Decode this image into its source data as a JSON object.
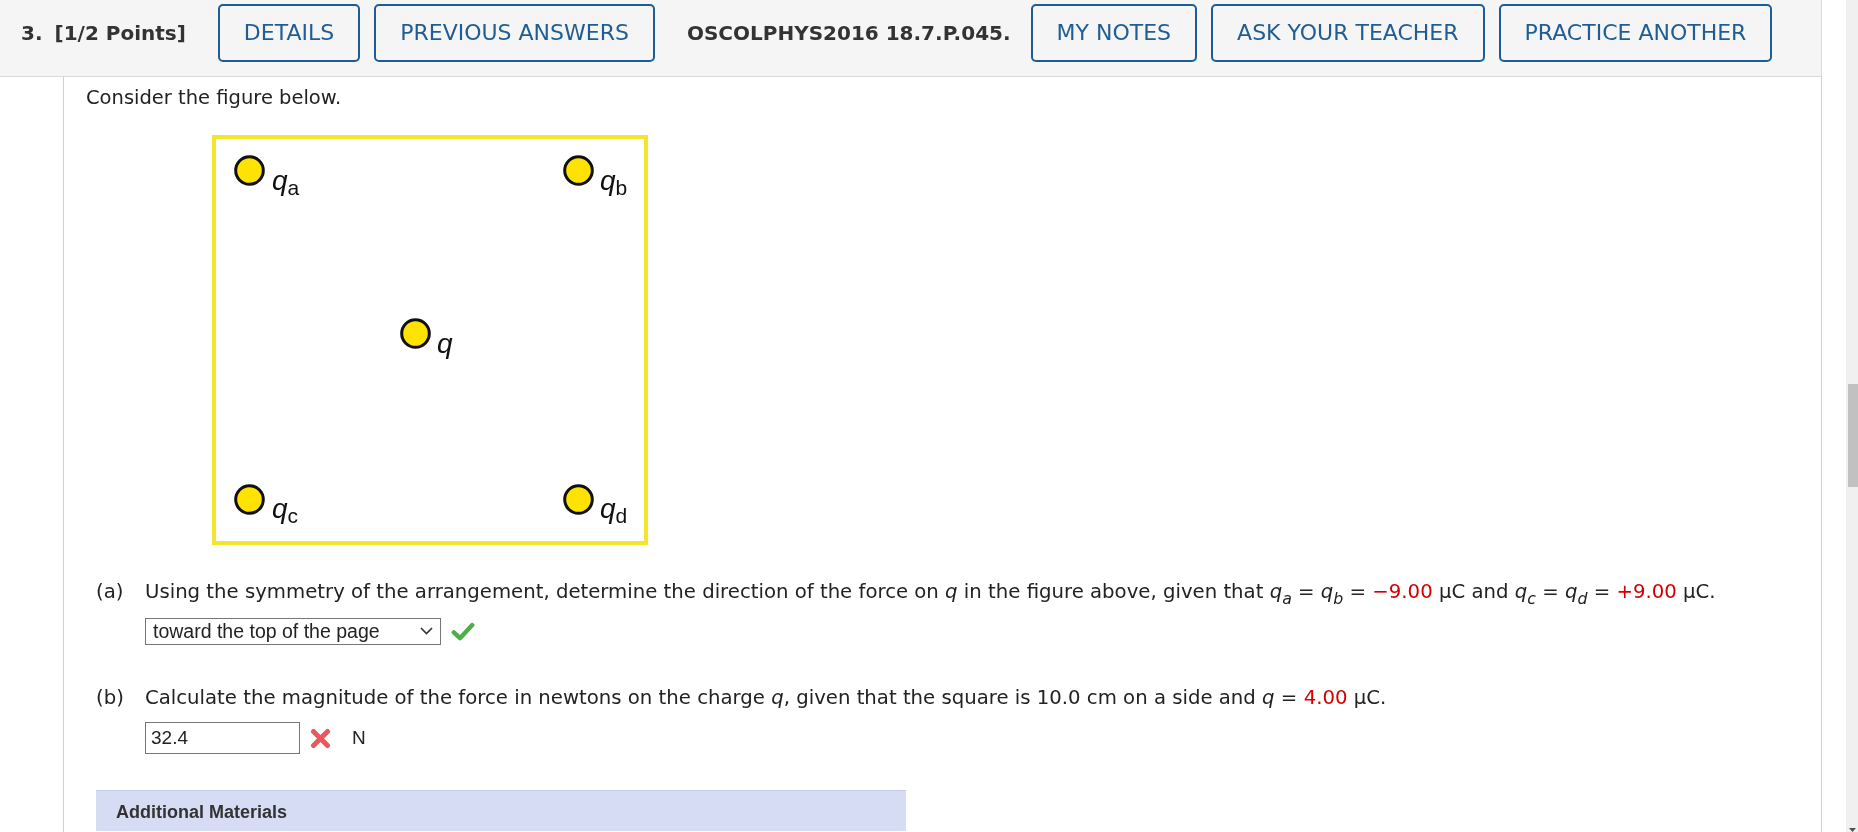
{
  "header": {
    "number": "3.",
    "points": "[1/2 Points]",
    "items": [
      {
        "kind": "button",
        "label": "DETAILS"
      },
      {
        "kind": "button",
        "label": "PREVIOUS ANSWERS"
      },
      {
        "kind": "code",
        "label": "OSCOLPHYS2016 18.7.P.045."
      },
      {
        "kind": "button",
        "label": "MY NOTES"
      },
      {
        "kind": "button",
        "label": "ASK YOUR TEACHER"
      },
      {
        "kind": "button",
        "label": "PRACTICE ANOTHER"
      }
    ]
  },
  "intro": "Consider the figure below.",
  "figure": {
    "charges": [
      {
        "label": "q$_{a}$"
      },
      {
        "label": "q$_{b}$"
      },
      {
        "label": "q"
      },
      {
        "label": "q$_{c}$"
      },
      {
        "label": "q$_{d}$"
      }
    ]
  },
  "parts": [
    {
      "label": "(a)",
      "segments": [
        {
          "kind": "text",
          "text": "Using the symmetry of the arrangement, determine the direction of the force on *q* in the figure above, given that *q*$_{a}$ = *q*$_{b}$ = "
        },
        {
          "kind": "value",
          "text": "−9.00"
        },
        {
          "kind": "text",
          "text": " µC and *q*$_{c}$ = *q*$_{d}$ = "
        },
        {
          "kind": "value",
          "text": "+9.00"
        },
        {
          "kind": "text",
          "text": " µC."
        }
      ],
      "answer": {
        "kind": "select",
        "value": "toward the top of the page",
        "correct": true
      }
    },
    {
      "label": "(b)",
      "segments": [
        {
          "kind": "text",
          "text": "Calculate the magnitude of the force in newtons on the charge *q*, given that the square is 10.0 cm on a side and *q* = "
        },
        {
          "kind": "value",
          "text": "4.00"
        },
        {
          "kind": "text",
          "text": " µC."
        }
      ],
      "answer": {
        "kind": "input",
        "value": "32.4",
        "correct": false,
        "unit": "N"
      }
    }
  ],
  "additional_materials": {
    "title": "Additional Materials"
  }
}
